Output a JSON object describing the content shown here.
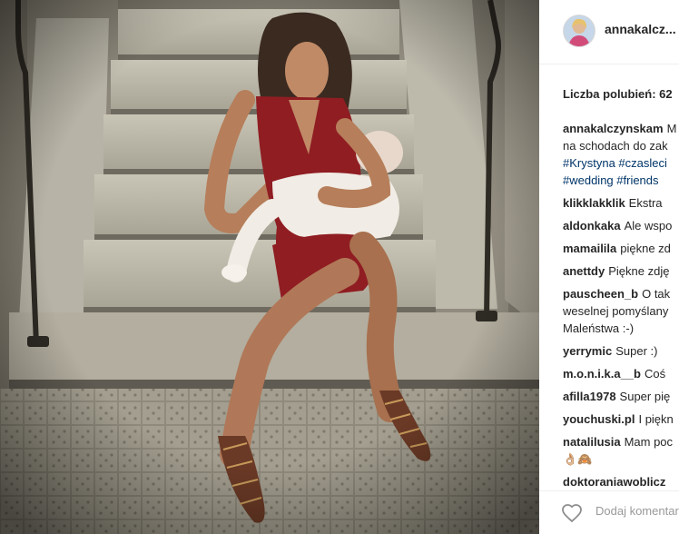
{
  "post": {
    "username": "annakalcz...",
    "likes_text": "Liczba polubień: 62",
    "add_comment_placeholder": "Dodaj komentarz"
  },
  "caption": {
    "user": "annakalczynskam",
    "lines": [
      "M",
      "na schodach do zak",
      "#Krystyna #czasleci",
      "#wedding #friends "
    ]
  },
  "comments": [
    {
      "user": "klikklakklik",
      "text": "Ekstra"
    },
    {
      "user": "aldonkaka",
      "text": "Ale wspo"
    },
    {
      "user": "mamailila",
      "text": "piękne zd"
    },
    {
      "user": "anettdy",
      "text": "Piękne zdję"
    },
    {
      "user": "pauscheen_b",
      "text": "O tak",
      "extra_lines": [
        "weselnej pomyślany",
        "Maleństwa :-)"
      ]
    },
    {
      "user": "yerrymic",
      "text": "Super :)"
    },
    {
      "user": "m.o.n.i.k.a__b",
      "text": "Coś"
    },
    {
      "user": "afilla1978",
      "text": "Super pię"
    },
    {
      "user": "youchuski.pl",
      "text": "I piękn"
    },
    {
      "user": "natalilusia",
      "text": "Mam poc",
      "extra_lines": [
        "👌🏼🙈"
      ]
    },
    {
      "user": "doktoraniawoblicz",
      "text": ""
    }
  ],
  "colors": {
    "link": "#003569",
    "text": "#262626",
    "muted": "#999999"
  }
}
